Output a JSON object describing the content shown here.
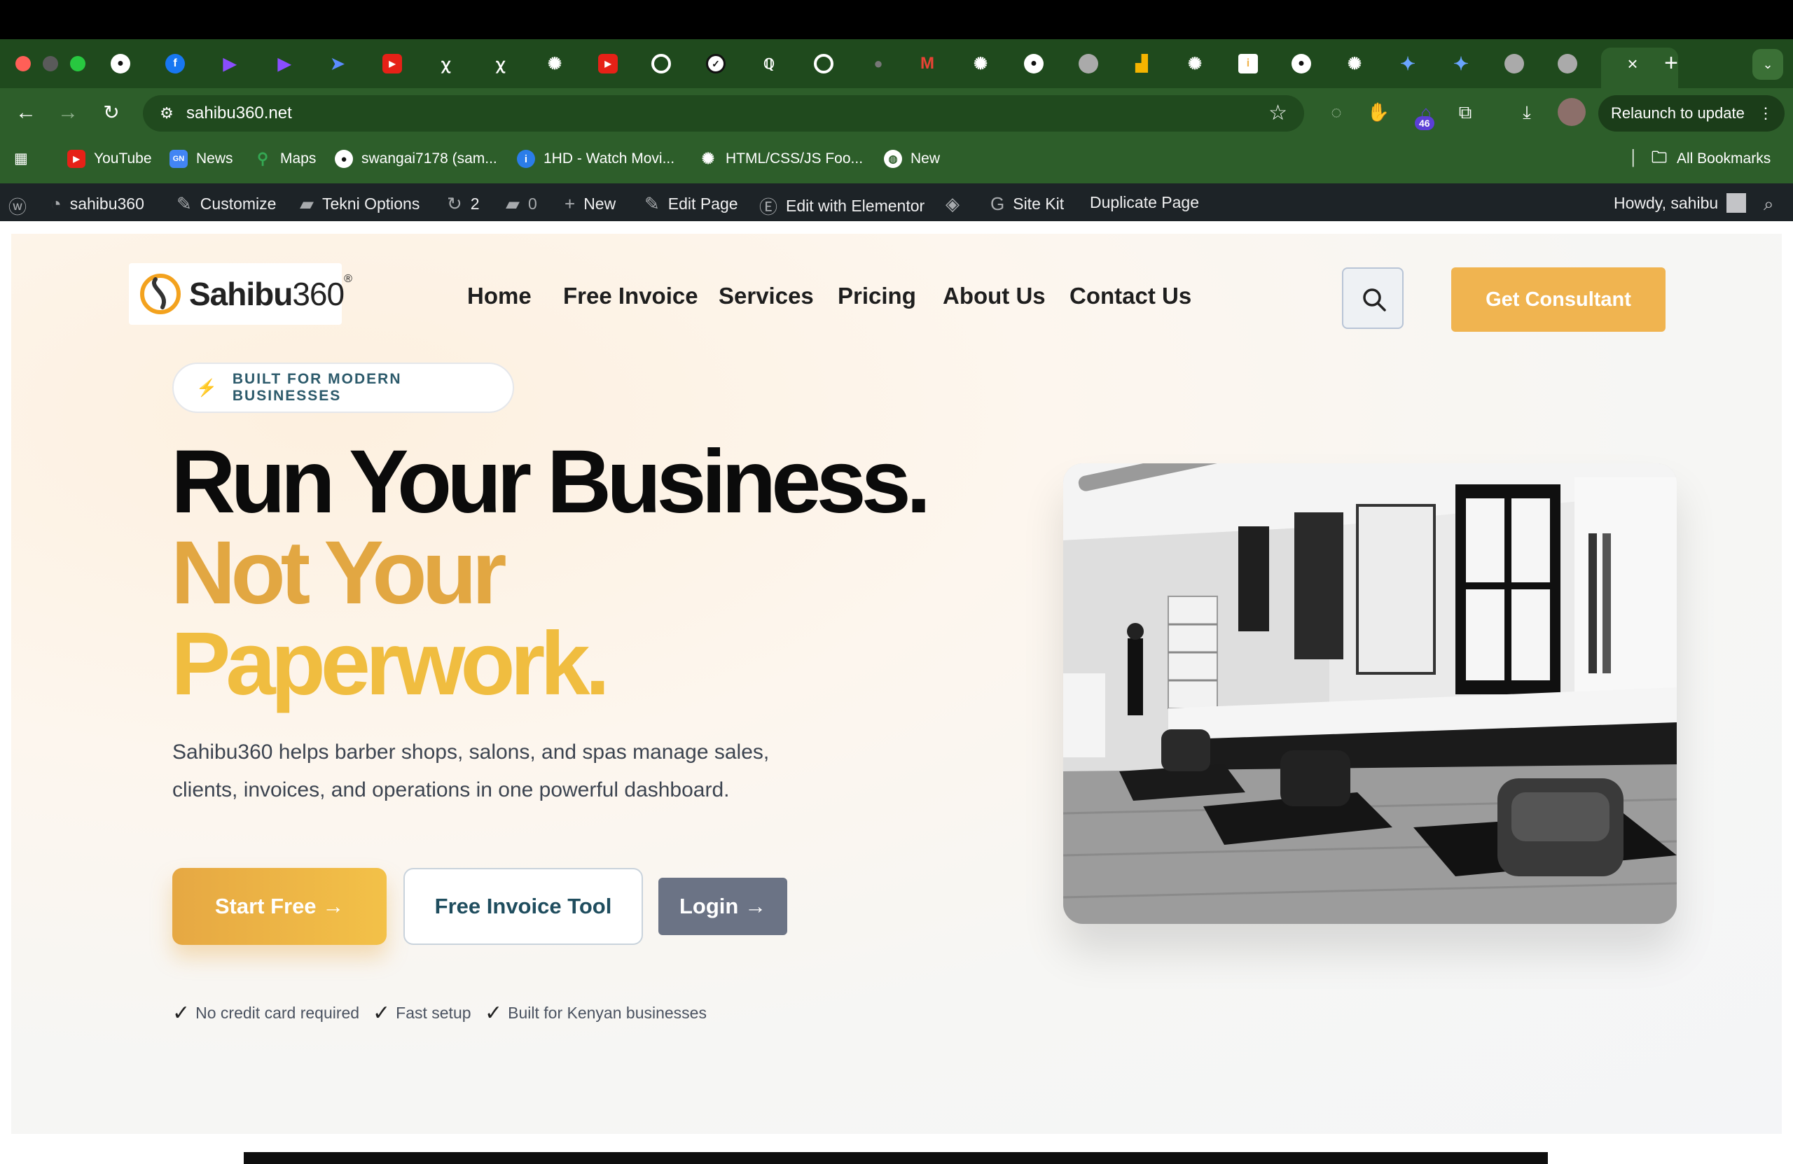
{
  "browser": {
    "url": "sahibu360.net",
    "relaunch_label": "Relaunch to update",
    "extension_badge": "46",
    "bookmarks": [
      {
        "label": "YouTube",
        "icon": "youtube-icon",
        "color": "#e62117"
      },
      {
        "label": "News",
        "icon": "news-icon",
        "color": "#4285f4"
      },
      {
        "label": "Maps",
        "icon": "maps-icon",
        "color": "#34a853"
      },
      {
        "label": "swangai7178 (sam...",
        "icon": "github-icon",
        "color": "#ffffff"
      },
      {
        "label": "1HD - Watch Movi...",
        "icon": "info-icon",
        "color": "#2b7de9"
      },
      {
        "label": "HTML/CSS/JS Foo...",
        "icon": "openai-icon",
        "color": "#ffffff"
      },
      {
        "label": "New",
        "icon": "globe-icon",
        "color": "#ffffff"
      }
    ],
    "all_bookmarks_label": "All Bookmarks"
  },
  "wp_admin": {
    "site_name": "sahibu360",
    "customize": "Customize",
    "tekni_options": "Tekni Options",
    "updates_count": "2",
    "comments_count": "0",
    "new": "New",
    "edit_page": "Edit Page",
    "edit_elementor": "Edit with Elementor",
    "site_kit": "Site Kit",
    "duplicate_page": "Duplicate Page",
    "howdy": "Howdy, sahibu"
  },
  "site": {
    "logo_name_bold": "Sahibu",
    "logo_name_light": "360",
    "logo_reg": "®",
    "nav": [
      "Home",
      "Free Invoice",
      "Services",
      "Pricing",
      "About Us",
      "Contact Us"
    ],
    "cta_label": "Get Consultant",
    "accent_color": "#f0b450"
  },
  "hero": {
    "pill_text": "BUILT FOR MODERN BUSINESSES",
    "headline_line1": "Run Your Business.",
    "headline_line2": "Not Your",
    "headline_line3": "Paperwork.",
    "subtext": "Sahibu360 helps barber shops, salons, and spas manage sales, clients, invoices, and operations in one powerful dashboard.",
    "btn_start": "Start Free →",
    "btn_invoice": "Free Invoice Tool",
    "btn_login": "Login →",
    "checks": [
      "No credit card required",
      "Fast setup",
      "Built for Kenyan businesses"
    ],
    "image_alt": "salon interior black and white photo"
  }
}
